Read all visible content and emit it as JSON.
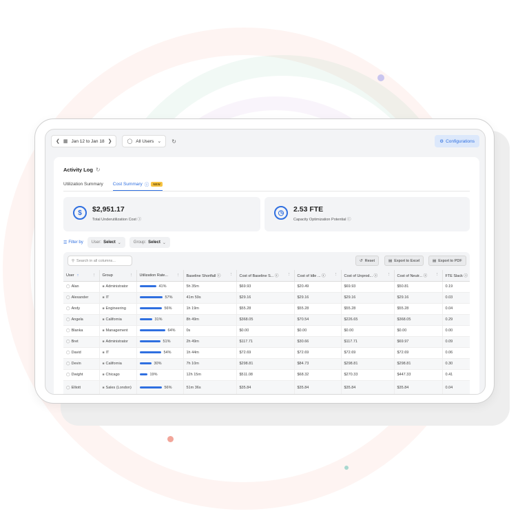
{
  "topbar": {
    "date_range": "Jan 12 to Jan 18",
    "users_filter": "All Users",
    "configurations_label": "Configurations"
  },
  "page": {
    "title": "Activity Log",
    "tabs": [
      {
        "label": "Utilization Summary",
        "active": false
      },
      {
        "label": "Cost Summary",
        "active": true,
        "badge": "NEW"
      }
    ]
  },
  "summary": {
    "cost_value": "$2,951.17",
    "cost_label": "Total Underutilization Cost",
    "fte_value": "2.53 FTE",
    "fte_label": "Capacity Optimization Potential"
  },
  "filter": {
    "label": "Filter by",
    "user_prefix": "User:",
    "user_value": "Select",
    "group_prefix": "Group:",
    "group_value": "Select"
  },
  "toolbar": {
    "search_placeholder": "Search in all columns...",
    "reset_label": "Reset",
    "excel_label": "Export to Excel",
    "pdf_label": "Export to PDF"
  },
  "table": {
    "columns": [
      "User",
      "Group",
      "Utilization Rate...",
      "Baseline Shortfall",
      "Cost of Baseline S...",
      "Cost of Idle ...",
      "Cost of Unprod...",
      "Cost of Neutr...",
      "FTE Slack"
    ],
    "rows": [
      {
        "user": "Alan",
        "group": "Administrator",
        "rate": 41,
        "rate_label": "41%",
        "shortfall": "5h 35m",
        "baseline": "$69.93",
        "idle": "$20.49",
        "unprod": "$69.93",
        "neutral": "$50.81",
        "fte": "0.19"
      },
      {
        "user": "Alexander",
        "group": "IT",
        "rate": 57,
        "rate_label": "57%",
        "shortfall": "41m 59s",
        "baseline": "$29.16",
        "idle": "$29.16",
        "unprod": "$29.16",
        "neutral": "$29.16",
        "fte": "0.03"
      },
      {
        "user": "Andy",
        "group": "Engineering",
        "rate": 56,
        "rate_label": "56%",
        "shortfall": "1h 19m",
        "baseline": "$55.28",
        "idle": "$55.28",
        "unprod": "$55.28",
        "neutral": "$55.28",
        "fte": "0.04"
      },
      {
        "user": "Angela",
        "group": "California",
        "rate": 31,
        "rate_label": "31%",
        "shortfall": "8h 49m",
        "baseline": "$368.05",
        "idle": "$70.54",
        "unprod": "$226.65",
        "neutral": "$368.05",
        "fte": "0.29"
      },
      {
        "user": "Blanka",
        "group": "Management",
        "rate": 64,
        "rate_label": "64%",
        "shortfall": "0s",
        "baseline": "$0.00",
        "idle": "$0.00",
        "unprod": "$0.00",
        "neutral": "$0.00",
        "fte": "0.00"
      },
      {
        "user": "Bret",
        "group": "Administrator",
        "rate": 51,
        "rate_label": "51%",
        "shortfall": "2h 49m",
        "baseline": "$117.71",
        "idle": "$30.66",
        "unprod": "$117.71",
        "neutral": "$69.97",
        "fte": "0.09"
      },
      {
        "user": "David",
        "group": "IT",
        "rate": 54,
        "rate_label": "54%",
        "shortfall": "1h 44m",
        "baseline": "$72.69",
        "idle": "$72.69",
        "unprod": "$72.69",
        "neutral": "$72.69",
        "fte": "0.06"
      },
      {
        "user": "Devin",
        "group": "California",
        "rate": 30,
        "rate_label": "30%",
        "shortfall": "7h 10m",
        "baseline": "$298.81",
        "idle": "$84.73",
        "unprod": "$298.81",
        "neutral": "$298.81",
        "fte": "0.30"
      },
      {
        "user": "Dwight",
        "group": "Chicago",
        "rate": 19,
        "rate_label": "19%",
        "shortfall": "12h 15m",
        "baseline": "$511.08",
        "idle": "$68.32",
        "unprod": "$270.33",
        "neutral": "$447.33",
        "fte": "0.41"
      },
      {
        "user": "Elliott",
        "group": "Sales (London)",
        "rate": 56,
        "rate_label": "56%",
        "shortfall": "51m 36s",
        "baseline": "$35.84",
        "idle": "$35.84",
        "unprod": "$35.84",
        "neutral": "$35.84",
        "fte": "0.04"
      }
    ]
  },
  "colors": {
    "accent": "#2f6fe0",
    "badge": "#f6c343"
  },
  "icons": [
    "chevron-left-icon",
    "calendar-icon",
    "chevron-right-icon",
    "user-icon",
    "chevron-down-icon",
    "refresh-icon",
    "gear-icon",
    "dollar-icon",
    "clock-icon",
    "filter-icon",
    "search-icon",
    "reset-icon",
    "file-icon",
    "info-icon",
    "folder-icon",
    "sort-up-icon",
    "column-menu-icon"
  ]
}
